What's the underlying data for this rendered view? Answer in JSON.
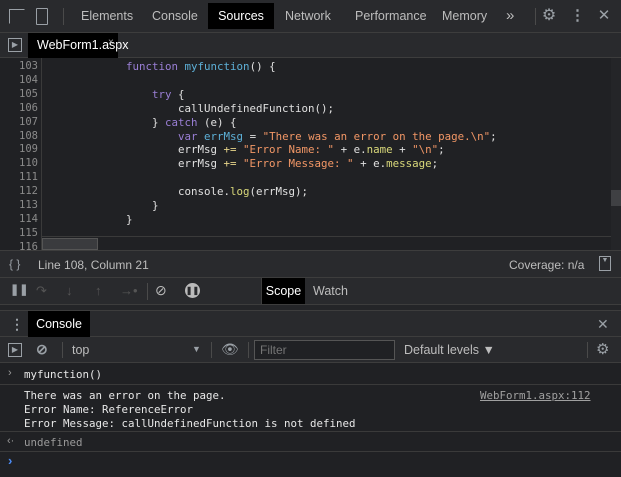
{
  "toolbar": {
    "tabs": [
      "Elements",
      "Console",
      "Sources",
      "Network",
      "Performance",
      "Memory"
    ],
    "active_tab": "Sources",
    "more": "»"
  },
  "editor": {
    "file_tab": "WebForm1.aspx",
    "line_numbers": [
      "103",
      "104",
      "105",
      "106",
      "107",
      "108",
      "109",
      "110",
      "111",
      "112",
      "113",
      "114",
      "115",
      "116"
    ],
    "lines": [
      [
        [
          "            ",
          ""
        ],
        [
          "function",
          "kw"
        ],
        [
          " ",
          ""
        ],
        [
          "myfunction",
          "def"
        ],
        [
          "() {",
          ""
        ]
      ],
      [],
      [
        [
          "                ",
          ""
        ],
        [
          "try",
          "kw"
        ],
        [
          " {",
          ""
        ]
      ],
      [
        [
          "                    callUndefinedFunction();",
          ""
        ]
      ],
      [
        [
          "                } ",
          ""
        ],
        [
          "catch",
          "kw"
        ],
        [
          " (e) {",
          ""
        ]
      ],
      [
        [
          "                    ",
          ""
        ],
        [
          "var",
          "kw"
        ],
        [
          " ",
          ""
        ],
        [
          "errMsg",
          "def"
        ],
        [
          " = ",
          ""
        ],
        [
          "\"There was an error on the page.\\n\"",
          "str"
        ],
        [
          ";",
          ""
        ]
      ],
      [
        [
          "                    errMsg ",
          ""
        ],
        [
          "+=",
          "op"
        ],
        [
          " ",
          ""
        ],
        [
          "\"Error Name: \"",
          "str"
        ],
        [
          " + e.",
          ""
        ],
        [
          "name",
          "prop"
        ],
        [
          " + ",
          ""
        ],
        [
          "\"\\n\"",
          "str"
        ],
        [
          ";",
          ""
        ]
      ],
      [
        [
          "                    errMsg ",
          ""
        ],
        [
          "+=",
          "op"
        ],
        [
          " ",
          ""
        ],
        [
          "\"Error Message: \"",
          "str"
        ],
        [
          " + e.",
          ""
        ],
        [
          "message",
          "prop"
        ],
        [
          ";",
          ""
        ]
      ],
      [],
      [
        [
          "                    console.",
          ""
        ],
        [
          "log",
          "prop"
        ],
        [
          "(errMsg);",
          ""
        ]
      ],
      [
        [
          "                }",
          ""
        ]
      ],
      [
        [
          "            }",
          ""
        ]
      ],
      [],
      []
    ]
  },
  "status": {
    "position": "Line 108, Column 21",
    "coverage": "Coverage: n/a"
  },
  "sidebar_tabs": {
    "scope": "Scope",
    "watch": "Watch"
  },
  "drawer": {
    "tab": "Console"
  },
  "console_toolbar": {
    "context": "top",
    "filter_placeholder": "Filter",
    "levels": "Default levels ▼"
  },
  "console": {
    "input": "myfunction()",
    "output": [
      "There was an error on the page.",
      "Error Name: ReferenceError",
      "Error Message: callUndefinedFunction is not defined"
    ],
    "source_link": "WebForm1.aspx:112",
    "result": "undefined"
  }
}
